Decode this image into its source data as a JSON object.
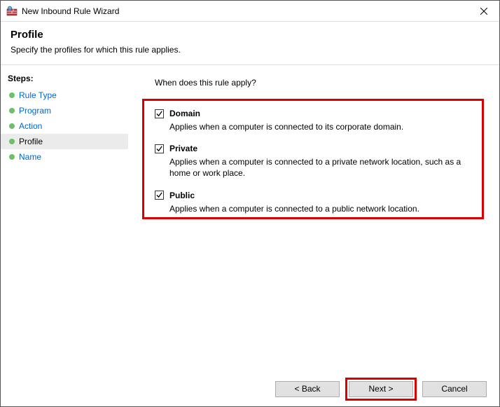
{
  "window": {
    "title": "New Inbound Rule Wizard"
  },
  "header": {
    "title": "Profile",
    "subtitle": "Specify the profiles for which this rule applies."
  },
  "sidebar": {
    "steps_label": "Steps:",
    "items": [
      {
        "label": "Rule Type"
      },
      {
        "label": "Program"
      },
      {
        "label": "Action"
      },
      {
        "label": "Profile"
      },
      {
        "label": "Name"
      }
    ],
    "active_index": 3
  },
  "content": {
    "prompt": "When does this rule apply?",
    "profiles": [
      {
        "name": "Domain",
        "description": "Applies when a computer is connected to its corporate domain.",
        "checked": true
      },
      {
        "name": "Private",
        "description": "Applies when a computer is connected to a private network location, such as a home or work place.",
        "checked": true
      },
      {
        "name": "Public",
        "description": "Applies when a computer is connected to a public network location.",
        "checked": true
      }
    ]
  },
  "footer": {
    "back": "< Back",
    "next": "Next >",
    "cancel": "Cancel"
  }
}
